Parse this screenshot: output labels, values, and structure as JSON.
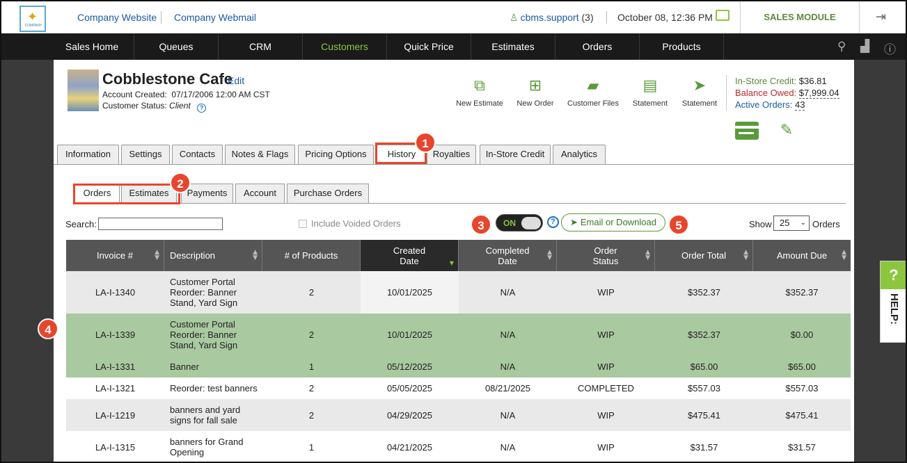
{
  "header": {
    "logo_text": "COMPANY",
    "links": [
      "Company Website",
      "Company Webmail"
    ],
    "user": "cbms.support",
    "user_count": "(3)",
    "datetime": "October 08, 12:36 PM",
    "module": "SALES MODULE"
  },
  "nav": {
    "items": [
      "Sales Home",
      "Queues",
      "CRM",
      "Customers",
      "Quick Price",
      "Estimates",
      "Orders",
      "Products"
    ],
    "active": "Customers"
  },
  "customer": {
    "name": "Cobblestone Cafe",
    "edit": "Edit",
    "created_label": "Account Created:",
    "created_value": "07/17/2006 12:00 AM CST",
    "status_label": "Customer Status:",
    "status_value": "Client"
  },
  "actions": [
    "New Estimate",
    "New Order",
    "Customer Files",
    "Statement",
    "Statement"
  ],
  "credit": {
    "instore_label": "In-Store Credit:",
    "instore_value": "$36.81",
    "balance_label": "Balance Owed:",
    "balance_value": "$7,999.04",
    "active_label": "Active Orders:",
    "active_value": "43"
  },
  "tabs": [
    "Information",
    "Settings",
    "Contacts",
    "Notes & Flags",
    "Pricing Options",
    "History",
    "Royalties",
    "In-Store Credit",
    "Analytics"
  ],
  "subtabs": [
    "Orders",
    "Estimates",
    "Payments",
    "Account",
    "Purchase Orders"
  ],
  "controls": {
    "search_label": "Search:",
    "search_value": "",
    "voided_label": "Include Voided Orders",
    "toggle_label": "ON",
    "email_button": "Email or Download",
    "show_label": "Show",
    "show_value": "25",
    "orders_label": "Orders"
  },
  "table": {
    "columns": [
      "Invoice #",
      "Description",
      "# of Products",
      "Created Date",
      "Completed Date",
      "Order Status",
      "Order Total",
      "Amount Due"
    ],
    "rows": [
      {
        "invoice": "LA-I-1340",
        "description": "Customer Portal Reorder: Banner Stand, Yard Sign",
        "products": "2",
        "created": "10/01/2025",
        "completed": "N/A",
        "status": "WIP",
        "total": "$352.37",
        "due": "$352.37"
      },
      {
        "invoice": "LA-I-1339",
        "description": "Customer Portal Reorder: Banner Stand, Yard Sign",
        "products": "2",
        "created": "10/01/2025",
        "completed": "N/A",
        "status": "WIP",
        "total": "$352.37",
        "due": "$0.00"
      },
      {
        "invoice": "LA-I-1331",
        "description": "Banner",
        "products": "1",
        "created": "05/12/2025",
        "completed": "N/A",
        "status": "WIP",
        "total": "$65.00",
        "due": "$65.00"
      },
      {
        "invoice": "LA-I-1321",
        "description": "Reorder: test banners",
        "products": "2",
        "created": "05/05/2025",
        "completed": "08/21/2025",
        "status": "COMPLETED",
        "total": "$557.03",
        "due": "$557.03"
      },
      {
        "invoice": "LA-I-1219",
        "description": "banners and yard signs for fall sale",
        "products": "2",
        "created": "04/29/2025",
        "completed": "N/A",
        "status": "WIP",
        "total": "$475.41",
        "due": "$475.41"
      },
      {
        "invoice": "LA-I-1315",
        "description": "banners for Grand Opening",
        "products": "1",
        "created": "04/21/2025",
        "completed": "N/A",
        "status": "WIP",
        "total": "$31.57",
        "due": "$31.57"
      }
    ]
  },
  "callouts": [
    "1",
    "2",
    "3",
    "4",
    "5"
  ],
  "help": {
    "q": "?",
    "label": "HELP:"
  },
  "colors": {
    "accent": "#8cc63f",
    "link": "#1b5aa6",
    "callout": "#e8452c",
    "row_highlight": "#a9c9a0",
    "nav_bg": "#1a1a1a"
  }
}
